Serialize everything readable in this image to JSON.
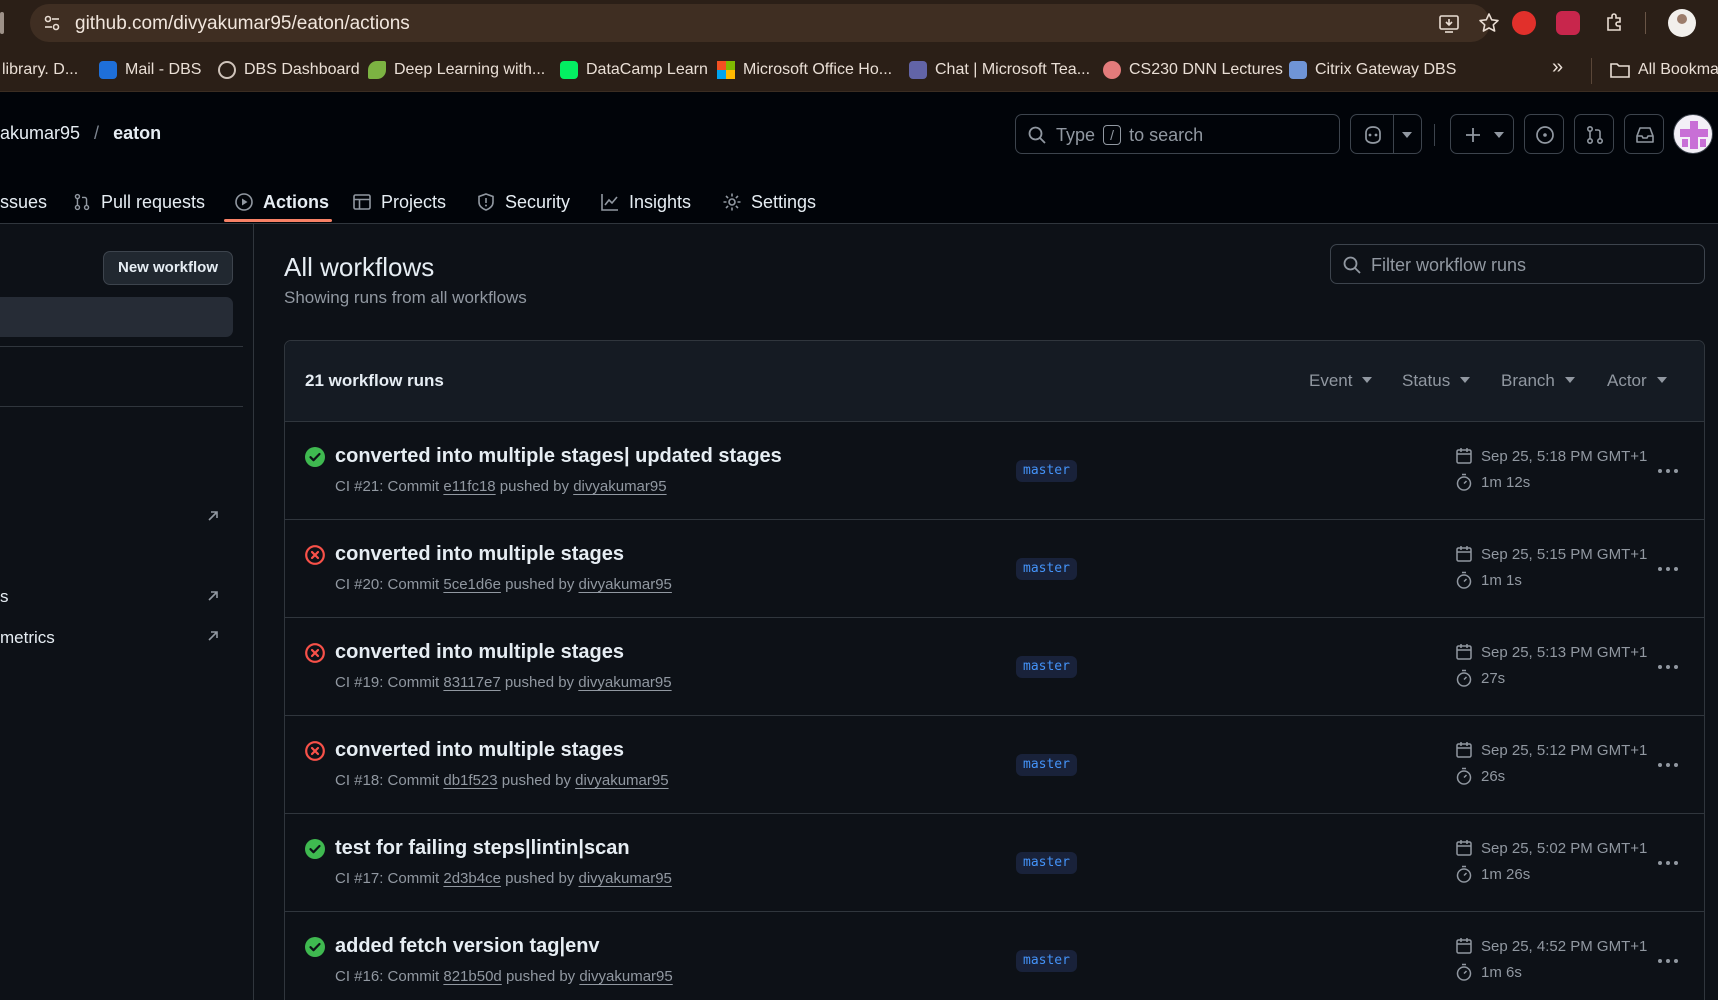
{
  "browser": {
    "url": "github.com/divyakumar95/eaton/actions",
    "bookmarks": [
      {
        "label": "library. D...",
        "icon": "bookmark-icon"
      },
      {
        "label": "Mail - DBS",
        "icon": "outlook-icon",
        "color": "#1e6fd9"
      },
      {
        "label": "DBS Dashboard",
        "icon": "globe-icon"
      },
      {
        "label": "Deep Learning with...",
        "icon": "leaf-icon",
        "color": "#7cb342"
      },
      {
        "label": "DataCamp Learn",
        "icon": "datacamp-icon",
        "color": "#03ef62"
      },
      {
        "label": "Microsoft Office Ho...",
        "icon": "microsoft-icon"
      },
      {
        "label": "Chat | Microsoft Tea...",
        "icon": "teams-icon",
        "color": "#6264a7"
      },
      {
        "label": "CS230 DNN Lectures",
        "icon": "cs230-icon",
        "color": "#e37b7b"
      },
      {
        "label": "Citrix Gateway DBS",
        "icon": "lock-icon",
        "color": "#6f94d6"
      }
    ],
    "more_label": "»",
    "all_bookmarks": "All Bookma"
  },
  "header": {
    "owner": "akumar95",
    "separator": "/",
    "repo": "eaton",
    "search_before": "Type",
    "search_key": "/",
    "search_after": "to search"
  },
  "tabs": [
    {
      "label": "ssues",
      "icon": "issue-icon"
    },
    {
      "label": "Pull requests",
      "icon": "pull-request-icon"
    },
    {
      "label": "Actions",
      "icon": "play-icon",
      "active": true
    },
    {
      "label": "Projects",
      "icon": "table-icon"
    },
    {
      "label": "Security",
      "icon": "shield-icon"
    },
    {
      "label": "Insights",
      "icon": "graph-icon"
    },
    {
      "label": "Settings",
      "icon": "gear-icon"
    }
  ],
  "sidebar": {
    "new_workflow": "New workflow",
    "links": [
      {
        "label": "s"
      },
      {
        "label": "metrics"
      }
    ]
  },
  "main": {
    "title": "All workflows",
    "subtitle": "Showing runs from all workflows",
    "filter_placeholder": "Filter workflow runs",
    "runs_count": "21 workflow runs",
    "filters": [
      "Event",
      "Status",
      "Branch",
      "Actor"
    ],
    "runs": [
      {
        "status": "success",
        "title": "converted into multiple stages| updated stages",
        "meta_prefix": "CI #21: Commit ",
        "commit": "e11fc18",
        "meta_mid": " pushed by ",
        "user": "divyakumar95",
        "branch": "master",
        "date": "Sep 25, 5:18 PM GMT+1",
        "duration": "1m 12s"
      },
      {
        "status": "failure",
        "title": "converted into multiple stages",
        "meta_prefix": "CI #20: Commit ",
        "commit": "5ce1d6e",
        "meta_mid": " pushed by ",
        "user": "divyakumar95",
        "branch": "master",
        "date": "Sep 25, 5:15 PM GMT+1",
        "duration": "1m 1s"
      },
      {
        "status": "failure",
        "title": "converted into multiple stages",
        "meta_prefix": "CI #19: Commit ",
        "commit": "83117e7",
        "meta_mid": " pushed by ",
        "user": "divyakumar95",
        "branch": "master",
        "date": "Sep 25, 5:13 PM GMT+1",
        "duration": "27s"
      },
      {
        "status": "failure",
        "title": "converted into multiple stages",
        "meta_prefix": "CI #18: Commit ",
        "commit": "db1f523",
        "meta_mid": " pushed by ",
        "user": "divyakumar95",
        "branch": "master",
        "date": "Sep 25, 5:12 PM GMT+1",
        "duration": "26s"
      },
      {
        "status": "success",
        "title": "test for failing steps|lintin|scan",
        "meta_prefix": "CI #17: Commit ",
        "commit": "2d3b4ce",
        "meta_mid": " pushed by ",
        "user": "divyakumar95",
        "branch": "master",
        "date": "Sep 25, 5:02 PM GMT+1",
        "duration": "1m 26s"
      },
      {
        "status": "success",
        "title": "added fetch version tag|env",
        "meta_prefix": "CI #16: Commit ",
        "commit": "821b50d",
        "meta_mid": " pushed by ",
        "user": "divyakumar95",
        "branch": "master",
        "date": "Sep 25, 4:52 PM GMT+1",
        "duration": "1m 6s"
      }
    ]
  },
  "colors": {
    "success": "#3fb950",
    "failure": "#f85149",
    "accent_underline": "#f78166",
    "branch_text": "#4493f8"
  }
}
